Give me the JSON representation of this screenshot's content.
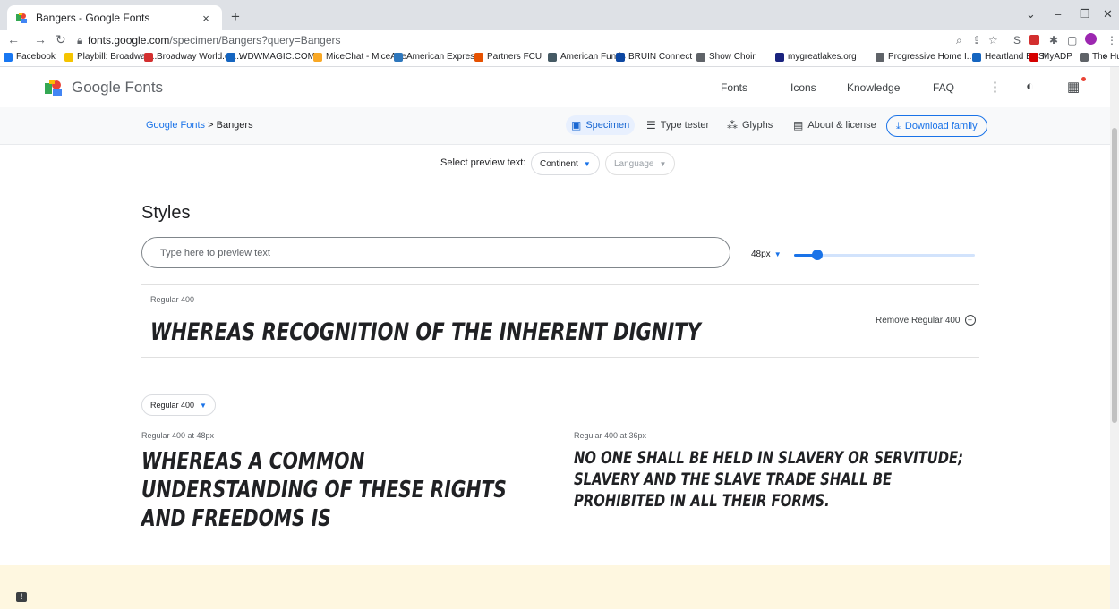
{
  "browser": {
    "tab_title": "Bangers - Google Fonts",
    "tab_close": "×",
    "new_tab": "+",
    "url_domain": "fonts.google.com",
    "url_path": "/specimen/Bangers?query=Bangers",
    "bookmarks": [
      {
        "label": "Facebook",
        "color": "#1877f2"
      },
      {
        "label": "Playbill: Broadway,...",
        "color": "#f5c400"
      },
      {
        "label": "Broadway World.co...",
        "color": "#d32f2f"
      },
      {
        "label": "WDWMAGIC.COM...",
        "color": "#1565c0"
      },
      {
        "label": "MiceChat - MiceAge",
        "color": "#f9a825"
      },
      {
        "label": "American Express",
        "color": "#2e77bc"
      },
      {
        "label": "Partners FCU",
        "color": "#e65100"
      },
      {
        "label": "American Funds",
        "color": "#455a64"
      },
      {
        "label": "BRUIN Connect",
        "color": "#0d47a1"
      },
      {
        "label": "Show Choir",
        "color": "#5f6368"
      },
      {
        "label": "mygreatlakes.org",
        "color": "#1a237e"
      },
      {
        "label": "Progressive Home I...",
        "color": "#5f6368"
      },
      {
        "label": "Heartland ECSI",
        "color": "#1565c0"
      },
      {
        "label": "MyADP",
        "color": "#d50000"
      },
      {
        "label": "The Hub",
        "color": "#5f6368"
      }
    ],
    "bookmarks_more": "»"
  },
  "header": {
    "brand": "Google Fonts",
    "nav": [
      "Fonts",
      "Icons",
      "Knowledge",
      "FAQ"
    ]
  },
  "subnav": {
    "crumb_root": "Google Fonts",
    "crumb_sep": ">",
    "crumb_current": "Bangers",
    "specimen": "Specimen",
    "type_tester": "Type tester",
    "glyphs": "Glyphs",
    "about": "About & license",
    "download": "Download family"
  },
  "preview": {
    "label": "Select preview text:",
    "continent": "Continent",
    "language": "Language"
  },
  "styles": {
    "title": "Styles",
    "input_placeholder": "Type here to preview text",
    "size": "48px",
    "slider_level": 0.13,
    "style_name": "Regular 400",
    "sample": "Whereas recognition of the inherent dignity",
    "remove": "Remove Regular 400"
  },
  "samples": {
    "dropdown": "Regular 400",
    "left_label": "Regular 400 at 48px",
    "left_text": "Whereas a common understanding of these rights and freedoms is",
    "right_label": "Regular 400 at 36px",
    "right_text": "No one shall be held in slavery or servitude; slavery and the slave trade shall be prohibited in all their forms."
  }
}
